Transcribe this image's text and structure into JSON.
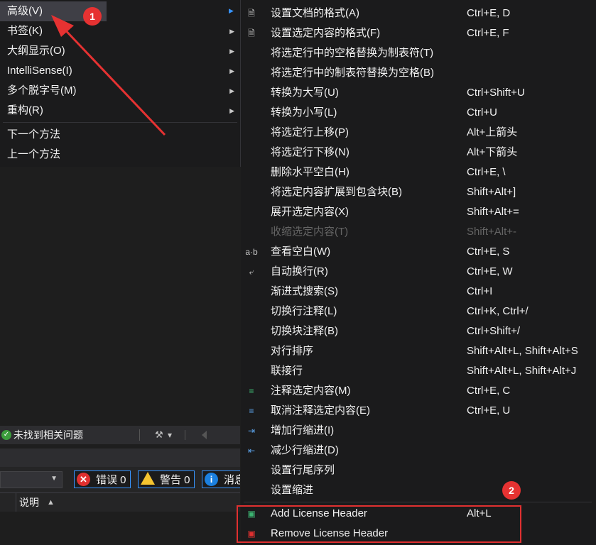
{
  "left_menu": {
    "items": [
      {
        "label": "高级(V)",
        "active": true
      },
      {
        "label": "书签(K)"
      },
      {
        "label": "大纲显示(O)"
      },
      {
        "label": "IntelliSense(I)"
      },
      {
        "label": "多个脱字号(M)"
      },
      {
        "label": "重构(R)"
      },
      {
        "label": "下一个方法"
      },
      {
        "label": "上一个方法"
      }
    ],
    "arrow_glyph": "▶"
  },
  "submenu": {
    "items": [
      {
        "label": "设置文档的格式(A)",
        "shortcut": "Ctrl+E, D",
        "icon": "document-format-icon"
      },
      {
        "label": "设置选定内容的格式(F)",
        "shortcut": "Ctrl+E, F",
        "icon": "selection-format-icon"
      },
      {
        "label": "将选定行中的空格替换为制表符(T)",
        "shortcut": ""
      },
      {
        "label": "将选定行中的制表符替换为空格(B)",
        "shortcut": ""
      },
      {
        "label": "转换为大写(U)",
        "shortcut": "Ctrl+Shift+U"
      },
      {
        "label": "转换为小写(L)",
        "shortcut": "Ctrl+U"
      },
      {
        "label": "将选定行上移(P)",
        "shortcut": "Alt+上箭头"
      },
      {
        "label": "将选定行下移(N)",
        "shortcut": "Alt+下箭头"
      },
      {
        "label": "删除水平空白(H)",
        "shortcut": "Ctrl+E, \\"
      },
      {
        "label": "将选定内容扩展到包含块(B)",
        "shortcut": "Shift+Alt+]"
      },
      {
        "label": "展开选定内容(X)",
        "shortcut": "Shift+Alt+="
      },
      {
        "label": "收缩选定内容(T)",
        "shortcut": "Shift+Alt+-",
        "disabled": true
      },
      {
        "label": "查看空白(W)",
        "shortcut": "Ctrl+E, S",
        "icon": "view-whitespace-icon",
        "icon_text": "a·b"
      },
      {
        "label": "自动换行(R)",
        "shortcut": "Ctrl+E, W",
        "icon": "word-wrap-icon"
      },
      {
        "label": "渐进式搜索(S)",
        "shortcut": "Ctrl+I"
      },
      {
        "label": "切换行注释(L)",
        "shortcut": "Ctrl+K, Ctrl+/"
      },
      {
        "label": "切换块注释(B)",
        "shortcut": "Ctrl+Shift+/"
      },
      {
        "label": "对行排序",
        "shortcut": "Shift+Alt+L, Shift+Alt+S"
      },
      {
        "label": "联接行",
        "shortcut": "Shift+Alt+L, Shift+Alt+J"
      },
      {
        "label": "注释选定内容(M)",
        "shortcut": "Ctrl+E, C",
        "icon": "comment-selection-icon"
      },
      {
        "label": "取消注释选定内容(E)",
        "shortcut": "Ctrl+E, U",
        "icon": "uncomment-selection-icon"
      },
      {
        "label": "增加行缩进(I)",
        "shortcut": "",
        "icon": "increase-indent-icon"
      },
      {
        "label": "减少行缩进(D)",
        "shortcut": "",
        "icon": "decrease-indent-icon"
      },
      {
        "label": "设置行尾序列",
        "shortcut": ""
      },
      {
        "label": "设置缩进",
        "shortcut": ""
      },
      {
        "label": "Add License Header",
        "shortcut": "Alt+L",
        "icon": "add-license-header-icon"
      },
      {
        "label": "Remove License Header",
        "shortcut": "",
        "icon": "remove-license-header-icon"
      }
    ]
  },
  "status": {
    "text": "未找到相关问题",
    "check_icon": "check-circle-icon",
    "brush_glyph": "▾"
  },
  "error_list": {
    "errors_label": "错误 0",
    "warnings_label": "警告 0",
    "messages_label": "消息"
  },
  "column_header": {
    "label": "说明",
    "sort_glyph": "▲"
  },
  "annotations": {
    "badge1": "1",
    "badge2": "2",
    "color": "#e63232"
  }
}
